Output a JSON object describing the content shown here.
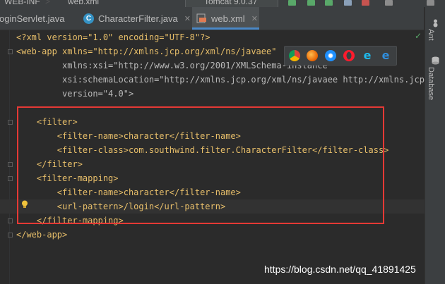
{
  "topbar": {
    "path_fragment": "WEB-INF",
    "open_file": "web.xml",
    "run_config": "Tomcat 9.0.37"
  },
  "tabs": [
    {
      "label": "oginServlet.java",
      "active": false
    },
    {
      "label": "CharacterFilter.java",
      "active": false
    },
    {
      "label": "web.xml",
      "active": true
    }
  ],
  "editor": {
    "lines": [
      "<?xml version=\"1.0\" encoding=\"UTF-8\"?>",
      "<web-app xmlns=\"http://xmlns.jcp.org/xml/ns/javaee\"",
      "         xmlns:xsi=\"http://www.w3.org/2001/XMLSchema-instance\"",
      "         xsi:schemaLocation=\"http://xmlns.jcp.org/xml/ns/javaee http://xmlns.jcp.or",
      "         version=\"4.0\">",
      "",
      "    <filter>",
      "        <filter-name>character</filter-name>",
      "        <filter-class>com.southwind.filter.CharacterFilter</filter-class>",
      "    </filter>",
      "    <filter-mapping>",
      "        <filter-name>character</filter-name>",
      "        <url-pattern>/login</url-pattern>",
      "    </filter-mapping>",
      "</web-app>"
    ]
  },
  "browser_popup": {
    "icons": [
      "chrome-icon",
      "firefox-icon",
      "safari-icon",
      "opera-icon",
      "ie-icon",
      "edge-icon"
    ]
  },
  "rightbar": {
    "ant_label": "Ant",
    "database_label": "Database"
  },
  "watermark": "https://blog.csdn.net/qq_41891425",
  "colors": {
    "background": "#2b2b2b",
    "tag": "#e8bf6a",
    "string": "#6a8759",
    "text": "#a9b7c6",
    "highlight_box": "#e53935",
    "active_tab_accent": "#4a88c7"
  }
}
